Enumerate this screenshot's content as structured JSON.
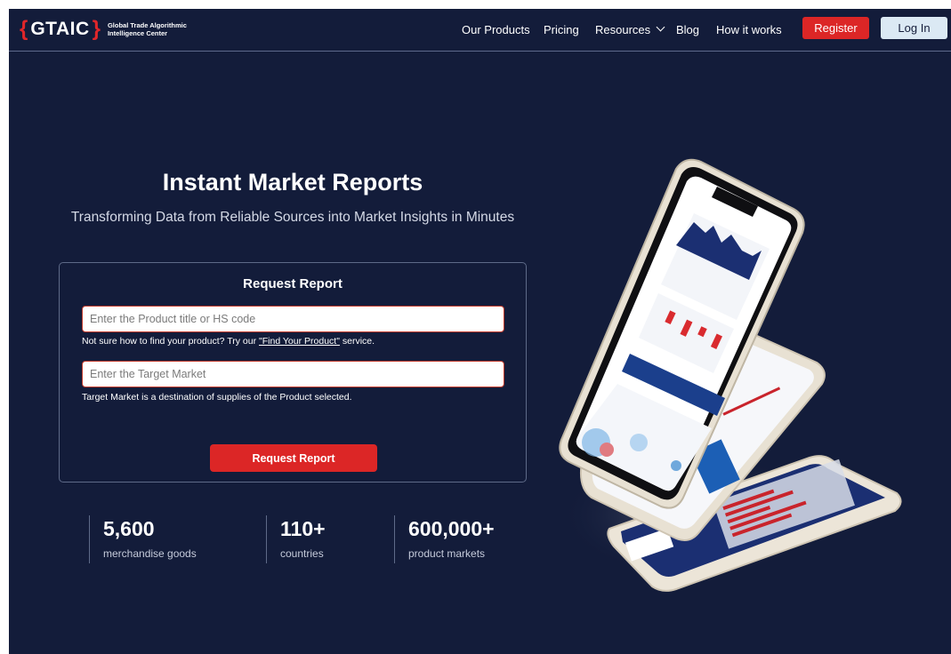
{
  "header": {
    "logo_left_brace": "{",
    "logo_word": "GTAIC",
    "logo_right_brace": "}",
    "logo_tagline": "Global Trade Algorithmic Intelligence Center",
    "nav": {
      "products": "Our Products",
      "pricing": "Pricing",
      "resources": "Resources",
      "blog": "Blog",
      "how": "How it works"
    },
    "register_label": "Register",
    "login_label": "Log In"
  },
  "hero": {
    "title": "Instant Market Reports",
    "subtitle": "Transforming Data from Reliable Sources into Market Insights in Minutes"
  },
  "request_card": {
    "title": "Request Report",
    "product_placeholder": "Enter the Product title or HS code",
    "product_hint_prefix": "Not sure how to find your product? Try our ",
    "product_hint_link": "\"Find Your Product\"",
    "product_hint_suffix": " service.",
    "market_placeholder": "Enter the Target Market",
    "market_hint": "Target Market is a destination of supplies of the Product selected.",
    "button_label": "Request Report"
  },
  "stats": [
    {
      "value": "5,600",
      "label": "merchandise goods"
    },
    {
      "value": "110+",
      "label": "countries"
    },
    {
      "value": "600,000+",
      "label": "product markets"
    }
  ],
  "colors": {
    "background": "#131c3a",
    "accent_red": "#dc2626",
    "login_bg": "#dbe9f4"
  }
}
